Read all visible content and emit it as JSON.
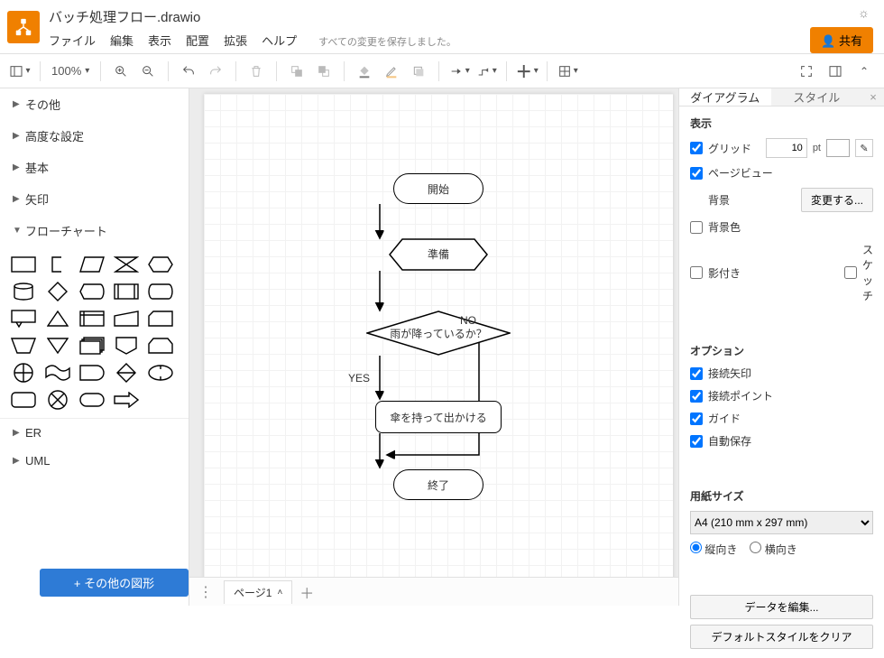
{
  "header": {
    "doc_title": "バッチ処理フロー.drawio",
    "menus": [
      "ファイル",
      "編集",
      "表示",
      "配置",
      "拡張",
      "ヘルプ"
    ],
    "save_status": "すべての変更を保存しました。",
    "share_label": "共有"
  },
  "toolbar": {
    "zoom": "100%"
  },
  "sidebar": {
    "categories": [
      {
        "label": "その他",
        "open": false
      },
      {
        "label": "高度な設定",
        "open": false
      },
      {
        "label": "基本",
        "open": false
      },
      {
        "label": "矢印",
        "open": false
      },
      {
        "label": "フローチャート",
        "open": true
      },
      {
        "label": "ER",
        "open": false
      },
      {
        "label": "UML",
        "open": false
      }
    ],
    "more_shapes": "+ その他の図形"
  },
  "flow": {
    "start": "開始",
    "prep": "準備",
    "decision": "雨が降っているか？",
    "yes": "YES",
    "no": "NO",
    "process": "傘を持って出かける",
    "end": "終了"
  },
  "page_tabs": {
    "page1": "ページ1"
  },
  "panel": {
    "tab_diagram": "ダイアグラム",
    "tab_style": "スタイル",
    "sec_view": "表示",
    "grid": "グリッド",
    "grid_value": "10",
    "grid_unit": "pt",
    "page_view": "ページビュー",
    "background": "背景",
    "change": "変更する...",
    "bg_color": "背景色",
    "shadow": "影付き",
    "sketch": "スケッチ",
    "sec_options": "オプション",
    "conn_arrows": "接続矢印",
    "conn_points": "接続ポイント",
    "guides": "ガイド",
    "autosave": "自動保存",
    "sec_paper": "用紙サイズ",
    "paper_size": "A4 (210 mm x 297 mm)",
    "portrait": "縦向き",
    "landscape": "横向き",
    "edit_data": "データを編集...",
    "clear_style": "デフォルトスタイルをクリア"
  }
}
